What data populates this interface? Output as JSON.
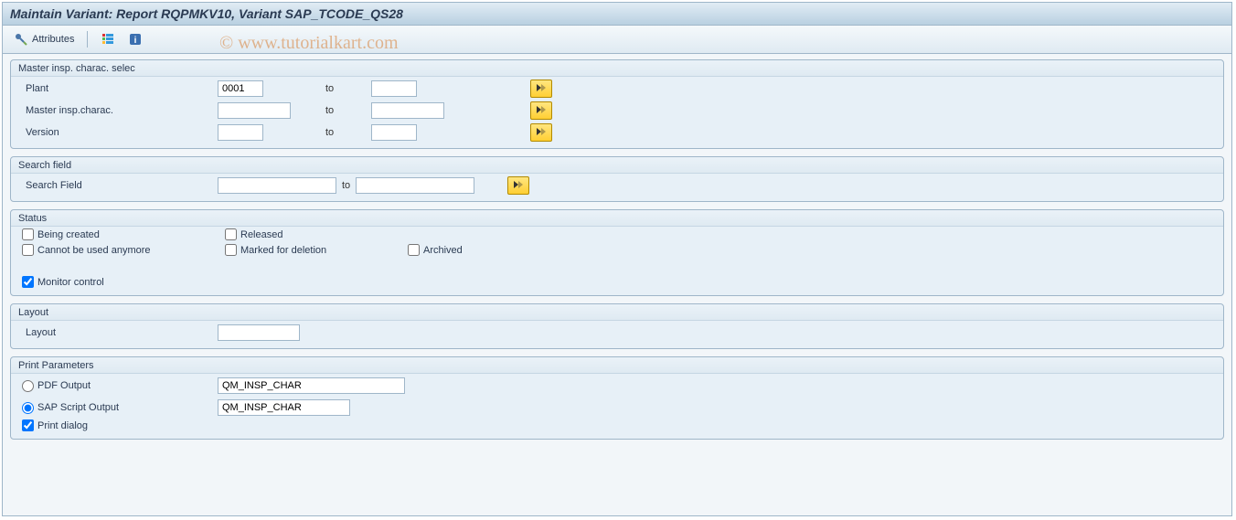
{
  "watermark": "© www.tutorialkart.com",
  "header": {
    "title": "Maintain Variant: Report RQPMKV10, Variant SAP_TCODE_QS28"
  },
  "toolbar": {
    "attributes_label": "Attributes"
  },
  "groups": {
    "master": {
      "title": "Master insp. charac. selec",
      "rows": {
        "plant": {
          "label": "Plant",
          "from": "0001",
          "to_label": "to",
          "to": ""
        },
        "mic": {
          "label": "Master insp.charac.",
          "from": "",
          "to_label": "to",
          "to": ""
        },
        "version": {
          "label": "Version",
          "from": "",
          "to_label": "to",
          "to": ""
        }
      }
    },
    "search": {
      "title": "Search field",
      "row": {
        "label": "Search Field",
        "from": "",
        "to_label": "to",
        "to": ""
      }
    },
    "status": {
      "title": "Status",
      "being_created": {
        "label": "Being created",
        "checked": false
      },
      "released": {
        "label": "Released",
        "checked": false
      },
      "cannot_be_used": {
        "label": "Cannot be used anymore",
        "checked": false
      },
      "marked_delete": {
        "label": "Marked for deletion",
        "checked": false
      },
      "archived": {
        "label": "Archived",
        "checked": false
      },
      "monitor": {
        "label": "Monitor control",
        "checked": true
      }
    },
    "layout": {
      "title": "Layout",
      "row": {
        "label": "Layout",
        "value": ""
      }
    },
    "print": {
      "title": "Print Parameters",
      "pdf": {
        "label": "PDF Output",
        "value": "QM_INSP_CHAR",
        "selected": false
      },
      "script": {
        "label": "SAP Script Output",
        "value": "QM_INSP_CHAR",
        "selected": true
      },
      "dialog": {
        "label": "Print dialog",
        "checked": true
      }
    }
  }
}
